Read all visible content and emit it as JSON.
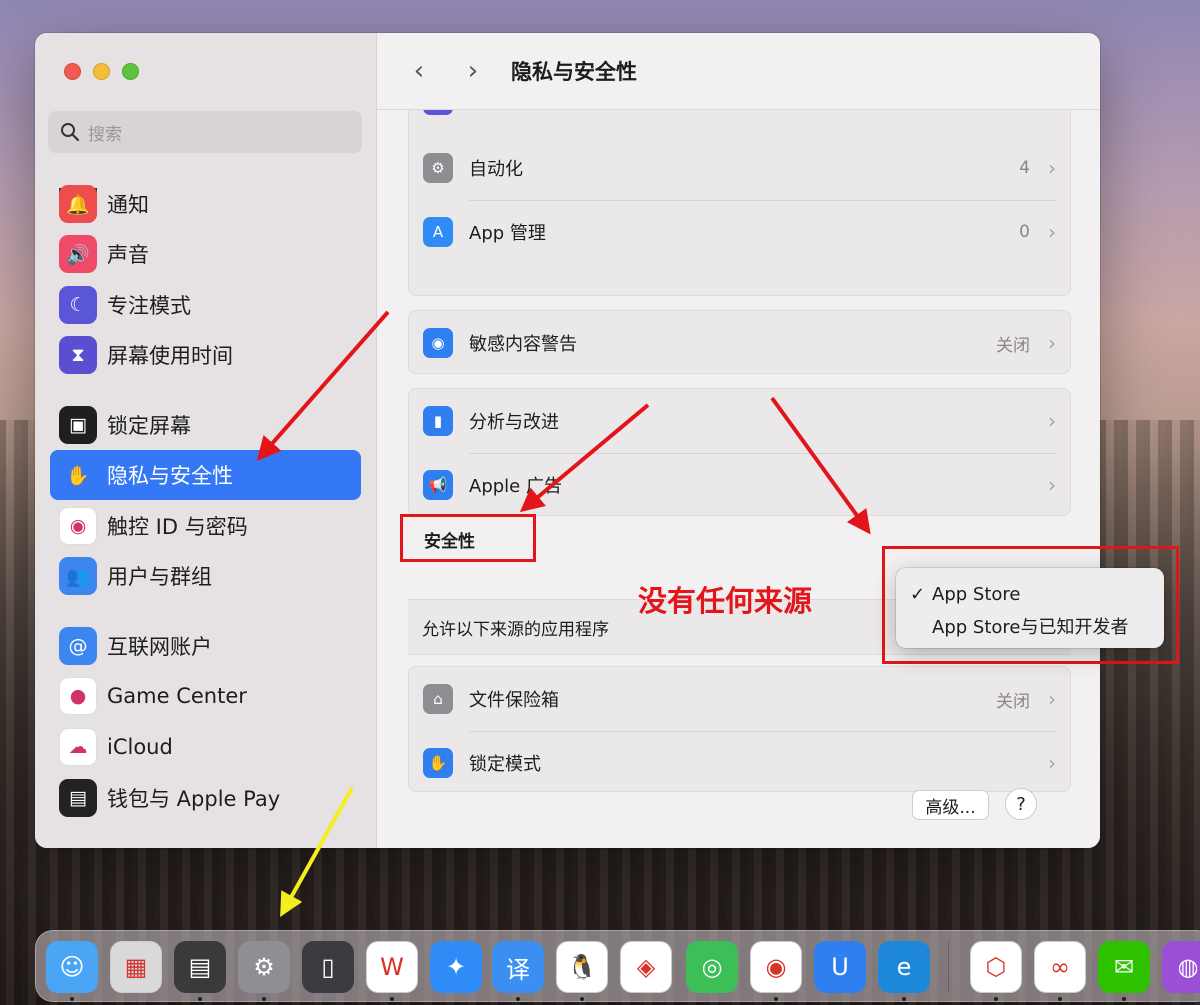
{
  "window": {
    "title": "隐私与安全性",
    "back_glyph": "‹",
    "forward_glyph": "›"
  },
  "search": {
    "placeholder": "搜索"
  },
  "sidebar": {
    "items": [
      {
        "label": "通知",
        "icon": "bell-icon",
        "color": "#ee4d4d"
      },
      {
        "label": "声音",
        "icon": "speaker-icon",
        "color": "#ef4a6a"
      },
      {
        "label": "专注模式",
        "icon": "moon-icon",
        "color": "#5a56d6"
      },
      {
        "label": "屏幕使用时间",
        "icon": "hourglass-icon",
        "color": "#5a4fd0"
      },
      {
        "label": "锁定屏幕",
        "icon": "lock-screen-icon",
        "color": "#1f1f1f"
      },
      {
        "label": "隐私与安全性",
        "icon": "hand-icon",
        "color": "#3478f6"
      },
      {
        "label": "触控 ID 与密码",
        "icon": "fingerprint-icon",
        "color": "#ffffff"
      },
      {
        "label": "用户与群组",
        "icon": "users-icon",
        "color": "#3d86f0"
      },
      {
        "label": "互联网账户",
        "icon": "at-icon",
        "color": "#3d86f0"
      },
      {
        "label": "Game Center",
        "icon": "game-center-icon",
        "color": "#ffffff"
      },
      {
        "label": "iCloud",
        "icon": "cloud-icon",
        "color": "#ffffff"
      },
      {
        "label": "钱包与 Apple Pay",
        "icon": "wallet-icon",
        "color": "#222222"
      }
    ]
  },
  "groups": {
    "g1": [
      {
        "label": "自动化",
        "value": "4",
        "icon": "gears-icon",
        "color": "#8d8d92"
      },
      {
        "label": "App 管理",
        "value": "0",
        "icon": "app-store-icon",
        "color": "#2f8cf6"
      }
    ],
    "g2": [
      {
        "label": "敏感内容警告",
        "value": "关闭",
        "icon": "eye-warning-icon",
        "color": "#2f7ff0"
      }
    ],
    "g3": [
      {
        "label": "分析与改进",
        "value": "",
        "icon": "bar-chart-icon",
        "color": "#2f7ff0"
      },
      {
        "label": "Apple 广告",
        "value": "",
        "icon": "megaphone-icon",
        "color": "#2f7ff0"
      }
    ],
    "g4": [
      {
        "label": "文件保险箱",
        "value": "关闭",
        "icon": "house-lock-icon",
        "color": "#8d8d92"
      },
      {
        "label": "锁定模式",
        "value": "",
        "icon": "hand-icon",
        "color": "#2f7ff0"
      }
    ]
  },
  "security": {
    "section_title": "安全性",
    "allow_label": "允许以下来源的应用程序",
    "annotation": "没有任何来源",
    "options": [
      {
        "label": "App Store",
        "checked": "✓"
      },
      {
        "label": "App Store与已知开发者",
        "checked": ""
      }
    ]
  },
  "buttons": {
    "advanced": "高级...",
    "help": "?"
  },
  "dock": [
    {
      "name": "finder-icon",
      "color": "#4aa6f4",
      "running": true,
      "glyph": "☺"
    },
    {
      "name": "launchpad-icon",
      "color": "#d9d9dc",
      "running": false,
      "glyph": "▦"
    },
    {
      "name": "calculator-icon",
      "color": "#3a3a3c",
      "running": true,
      "glyph": "▤"
    },
    {
      "name": "system-settings-icon",
      "color": "#8e8e93",
      "running": true,
      "glyph": "⚙"
    },
    {
      "name": "iphone-mirroring-icon",
      "color": "#3c3c40",
      "running": false,
      "glyph": "▯"
    },
    {
      "name": "wps-icon",
      "color": "#ffffff",
      "running": true,
      "glyph": "W"
    },
    {
      "name": "safari-icon",
      "color": "#2f8cf6",
      "running": false,
      "glyph": "✦"
    },
    {
      "name": "translate-icon",
      "color": "#3a8ff0",
      "running": true,
      "glyph": "译"
    },
    {
      "name": "qq-icon",
      "color": "#ffffff",
      "running": true,
      "glyph": "🐧"
    },
    {
      "name": "sketchup-icon",
      "color": "#ffffff",
      "running": false,
      "glyph": "◈"
    },
    {
      "name": "findmy-icon",
      "color": "#3cbf56",
      "running": false,
      "glyph": "◎"
    },
    {
      "name": "netease-music-icon",
      "color": "#ffffff",
      "running": true,
      "glyph": "◉"
    },
    {
      "name": "bytedance-app-icon",
      "color": "#2f7ff0",
      "running": false,
      "glyph": "U"
    },
    {
      "name": "edge-icon",
      "color": "#1e88d8",
      "running": true,
      "glyph": "e"
    },
    {
      "name": "cloud-drive-icon",
      "color": "#ffffff",
      "running": true,
      "glyph": "⬡"
    },
    {
      "name": "baidu-netdisk-icon",
      "color": "#ffffff",
      "running": true,
      "glyph": "∞"
    },
    {
      "name": "wechat-icon",
      "color": "#2dc100",
      "running": true,
      "glyph": "✉"
    },
    {
      "name": "podcasts-icon",
      "color": "#9b4fd6",
      "running": false,
      "glyph": "◍"
    }
  ]
}
